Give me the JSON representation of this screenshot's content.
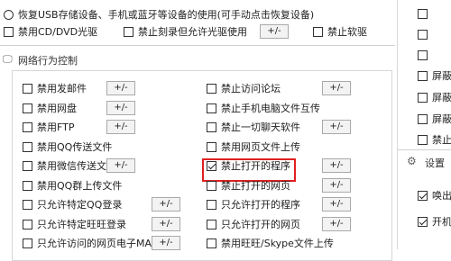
{
  "top": {
    "restore_option": "恢复USB存储设备、手机或蓝牙等设备的使用(可手动点击恢复设备)",
    "disable_cd_dvd": "禁用CD/DVD光驱",
    "disable_burn": "禁止刻录但允许光驱使用",
    "disable_floppy": "禁止软驱",
    "plus_minus": "+/-"
  },
  "network_section": {
    "title": "网络行为控制",
    "left_items": [
      {
        "label": "禁用发邮件",
        "btn": "+/-"
      },
      {
        "label": "禁用网盘",
        "btn": "+/-"
      },
      {
        "label": "禁用FTP",
        "btn": "+/-"
      },
      {
        "label": "禁用QQ传送文件",
        "btn": ""
      },
      {
        "label": "禁用微信传送文件",
        "btn": "+/-"
      },
      {
        "label": "禁用QQ群上传文件",
        "btn": ""
      },
      {
        "label": "只允许特定QQ登录",
        "btn": "+/-"
      },
      {
        "label": "只允许特定旺旺登录",
        "btn": "+/-"
      },
      {
        "label": "只允许访问的网页电子MAC地址",
        "btn": "+/-"
      }
    ],
    "right_items": [
      {
        "label": "禁止访问论坛",
        "btn": "+/-",
        "checked": false
      },
      {
        "label": "禁止手机电脑文件互传",
        "btn": "",
        "checked": false
      },
      {
        "label": "禁止一切聊天软件",
        "btn": "+/-",
        "checked": false
      },
      {
        "label": "禁用网页文件上传",
        "btn": "",
        "checked": false
      },
      {
        "label": "禁止打开的程序",
        "btn": "+/-",
        "checked": true
      },
      {
        "label": "禁止打开的网页",
        "btn": "+/-",
        "checked": false
      },
      {
        "label": "只允许打开的程序",
        "btn": "+/-",
        "checked": false
      },
      {
        "label": "只允许打开的网页",
        "btn": "+/-",
        "checked": false
      },
      {
        "label": "禁用旺旺/Skype文件上传",
        "btn": "",
        "checked": false
      }
    ]
  },
  "right_panel": {
    "items": [
      "屏蔽",
      "屏蔽",
      "屏蔽",
      "禁止"
    ],
    "settings_title": "设置",
    "options": [
      "唤出",
      "开机"
    ]
  }
}
